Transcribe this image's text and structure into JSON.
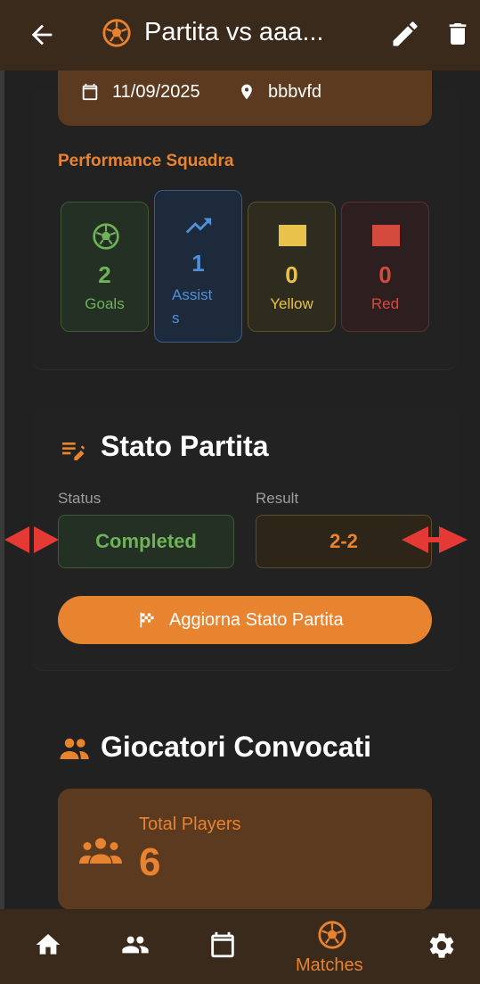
{
  "app_bar": {
    "title": "Partita vs aaa...",
    "icons": [
      "arrow-back-icon",
      "soccer-ball-icon",
      "edit-icon",
      "delete-icon"
    ]
  },
  "match_info": {
    "date": "11/09/2025",
    "location": "bbbvfd"
  },
  "performance": {
    "title": "Performance Squadra",
    "stats": [
      {
        "label": "Goals",
        "value": "2",
        "color": "#6fb257",
        "icon": "soccer-ball-icon"
      },
      {
        "label": "Assist\ns",
        "value": "1",
        "color": "#4e90d9",
        "icon": "trending-up-icon"
      },
      {
        "label": "Yellow",
        "value": "0",
        "color": "#e8c24a",
        "icon": "yellow-card-icon"
      },
      {
        "label": "Red",
        "value": "0",
        "color": "#d44a3c",
        "icon": "red-card-icon"
      }
    ]
  },
  "match_state": {
    "title": "Stato Partita",
    "status_label": "Status",
    "status_value": "Completed",
    "result_label": "Result",
    "result_value": "2-2",
    "update_button": "Aggiorna Stato Partita"
  },
  "players": {
    "title": "Giocatori Convocati",
    "total_label": "Total Players",
    "total_value": "6"
  },
  "bottom_nav": {
    "items": [
      {
        "icon": "home-icon"
      },
      {
        "icon": "people-icon"
      },
      {
        "icon": "calendar-icon"
      },
      {
        "icon": "soccer-ball-icon",
        "label": "Matches",
        "active": true
      },
      {
        "icon": "settings-icon"
      }
    ]
  },
  "colors": {
    "accent": "#e8832f",
    "appbar": "#3a2a1c",
    "card_brown": "#5b3a1f",
    "background": "#212121"
  }
}
